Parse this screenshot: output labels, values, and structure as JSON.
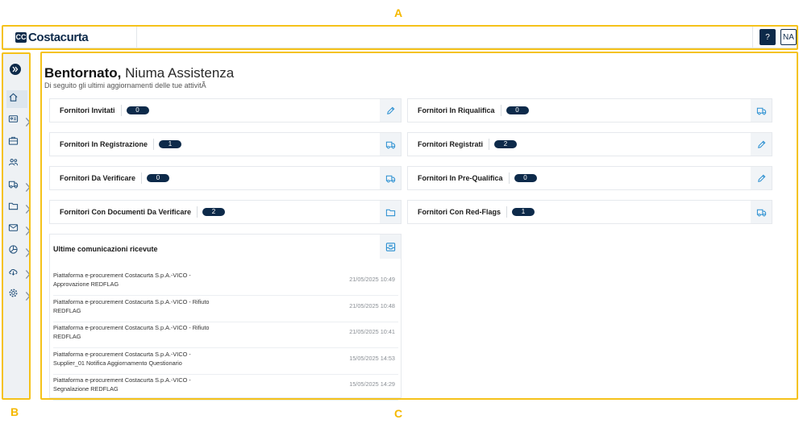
{
  "callouts": {
    "a": "A",
    "b": "B",
    "c": "C"
  },
  "header": {
    "logo_mark": "CC",
    "logo_text": "Costacurta",
    "help_label": "?",
    "user_initials": "NA"
  },
  "sidebar": {
    "items": [
      {
        "icon": "home-icon"
      },
      {
        "icon": "id-card-icon",
        "chevron": true
      },
      {
        "icon": "briefcase-icon"
      },
      {
        "icon": "users-icon"
      },
      {
        "icon": "truck-icon",
        "chevron": true
      },
      {
        "icon": "folder-icon",
        "chevron": true
      },
      {
        "icon": "mail-icon",
        "chevron": true
      },
      {
        "icon": "pie-chart-icon",
        "chevron": true
      },
      {
        "icon": "cloud-download-icon",
        "chevron": true
      },
      {
        "icon": "settings-icon",
        "chevron": true
      }
    ]
  },
  "main": {
    "greeting_bold": "Bentornato,",
    "greeting_name": " Niuma Assistenza",
    "subtitle": "Di seguito gli ultimi aggiornamenti delle tue attivitÃ",
    "cards": [
      {
        "label": "Fornitori Invitati",
        "count": "0",
        "icon": "pencil-icon"
      },
      {
        "label": "Fornitori In Riqualifica",
        "count": "0",
        "icon": "truck-icon"
      },
      {
        "label": "Fornitori In Registrazione",
        "count": "1",
        "icon": "truck-icon"
      },
      {
        "label": "Fornitori Registrati",
        "count": "2",
        "icon": "pencil-icon"
      },
      {
        "label": "Fornitori Da Verificare",
        "count": "0",
        "icon": "truck-icon"
      },
      {
        "label": "Fornitori In Pre-Qualifica",
        "count": "0",
        "icon": "pencil-icon"
      },
      {
        "label": "Fornitori Con Documenti Da Verificare",
        "count": "2",
        "icon": "folder-icon"
      },
      {
        "label": "Fornitori Con Red-Flags",
        "count": "1",
        "icon": "truck-icon"
      }
    ],
    "comms": {
      "title": "Ultime comunicazioni ricevute",
      "icon": "inbox-icon",
      "messages": [
        {
          "text": "Piattaforma e-procurement Costacurta S.p.A.-VICO - Approvazione REDFLAG",
          "date": "21/05/2025 10:49"
        },
        {
          "text": "Piattaforma e-procurement Costacurta S.p.A.-VICO - Rifiuto REDFLAG",
          "date": "21/05/2025 10:48"
        },
        {
          "text": "Piattaforma e-procurement Costacurta S.p.A.-VICO - Rifiuto REDFLAG",
          "date": "21/05/2025 10:41"
        },
        {
          "text": "Piattaforma e-procurement Costacurta S.p.A.-VICO - Supplier_01 Notifica Aggiornamento Questionario",
          "date": "15/05/2025 14:53"
        },
        {
          "text": "Piattaforma e-procurement Costacurta S.p.A.-VICO - Segnalazione REDFLAG",
          "date": "15/05/2025 14:29"
        }
      ]
    }
  },
  "colors": {
    "primary": "#0d2a4a",
    "accent": "#2a8fd1",
    "callout": "#f5c21a"
  }
}
